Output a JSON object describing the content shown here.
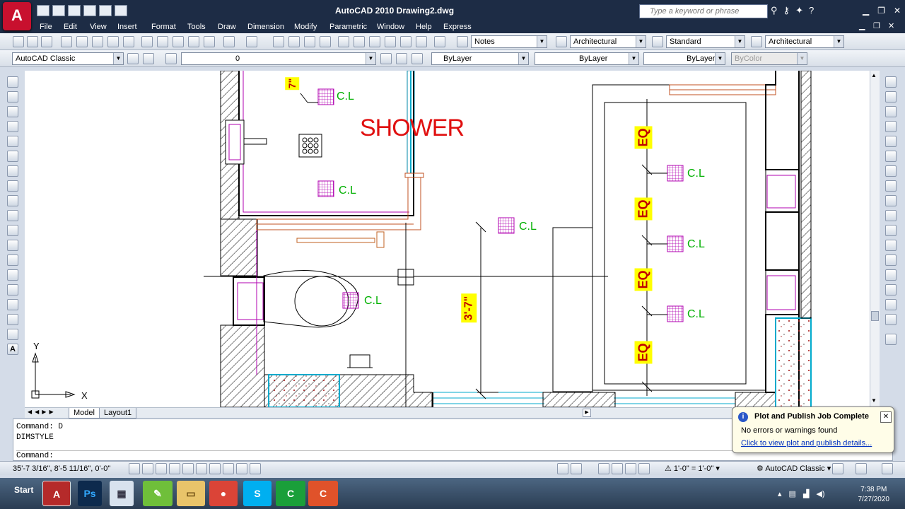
{
  "title": "AutoCAD 2010     Drawing2.dwg",
  "logo_text": "A",
  "search": {
    "placeholder": "Type a keyword or phrase"
  },
  "menu": [
    "File",
    "Edit",
    "View",
    "Insert",
    "Format",
    "Tools",
    "Draw",
    "Dimension",
    "Modify",
    "Parametric",
    "Window",
    "Help",
    "Express"
  ],
  "toolbar1": {
    "text_style": "Notes",
    "dim_style": "Architectural",
    "table_style": "Standard",
    "multileader_style": "Architectural"
  },
  "toolbar2": {
    "workspace": "AutoCAD Classic",
    "layer": "0",
    "color": "ByLayer",
    "linetype": "ByLayer",
    "lineweight": "ByLayer",
    "plotstyle": "ByColor"
  },
  "drawing": {
    "shower_label": "SHOWER",
    "dim_7": "7\"",
    "dim_3_7": "3'-7\"",
    "cl": "C.L",
    "eq": "EQ"
  },
  "ucs": {
    "x": "X",
    "y": "Y"
  },
  "tabs": [
    "Model",
    "Layout1"
  ],
  "command": {
    "line1": "Command: D",
    "line2": "DIMSTYLE",
    "line3": "Command:"
  },
  "status": {
    "coords": "35'-7 3/16\",  8'-5 11/16\", 0'-0\"",
    "annotation_scale": "1'-0\" = 1'-0\"",
    "workspace": "AutoCAD Classic"
  },
  "notification": {
    "title": "Plot and Publish Job Complete",
    "body": "No errors or warnings found",
    "link": "Click to view plot and publish details..."
  },
  "taskbar": {
    "start": "Start",
    "time": "7:38 PM",
    "date": "7/27/2020"
  },
  "colors": {
    "accent": "#1d2c45",
    "cad_magenta": "#b000b0",
    "cad_green": "#00b000",
    "cad_red": "#e01010",
    "cad_yellow": "#ffff00"
  }
}
